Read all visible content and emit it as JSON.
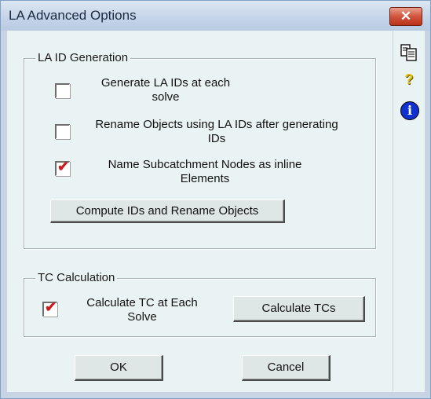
{
  "window": {
    "title": "LA Advanced Options",
    "close_glyph": "✕"
  },
  "la_id_group": {
    "legend": "LA ID Generation",
    "options": [
      {
        "line1": "Generate LA IDs at each",
        "line2": "solve",
        "checked": false
      },
      {
        "line1": "Rename Objects using LA IDs after generating",
        "line2": "IDs",
        "checked": false
      },
      {
        "line1": "Name Subcatchment Nodes as inline",
        "line2": "Elements",
        "checked": true
      }
    ],
    "compute_button": "Compute IDs and Rename Objects"
  },
  "tc_group": {
    "legend": "TC Calculation",
    "option": {
      "line1": "Calculate TC at Each",
      "line2": "Solve",
      "checked": true
    },
    "calculate_button": "Calculate TCs"
  },
  "buttons": {
    "ok": "OK",
    "cancel": "Cancel"
  },
  "side_icons": [
    {
      "name": "copy-icon"
    },
    {
      "name": "help-question-icon",
      "glyph": "?"
    },
    {
      "name": "info-icon",
      "glyph": "i"
    }
  ],
  "colors": {
    "check": "#cc1a1a",
    "info": "#1030d0",
    "help": "#e0c000",
    "close": "#c8422a"
  }
}
